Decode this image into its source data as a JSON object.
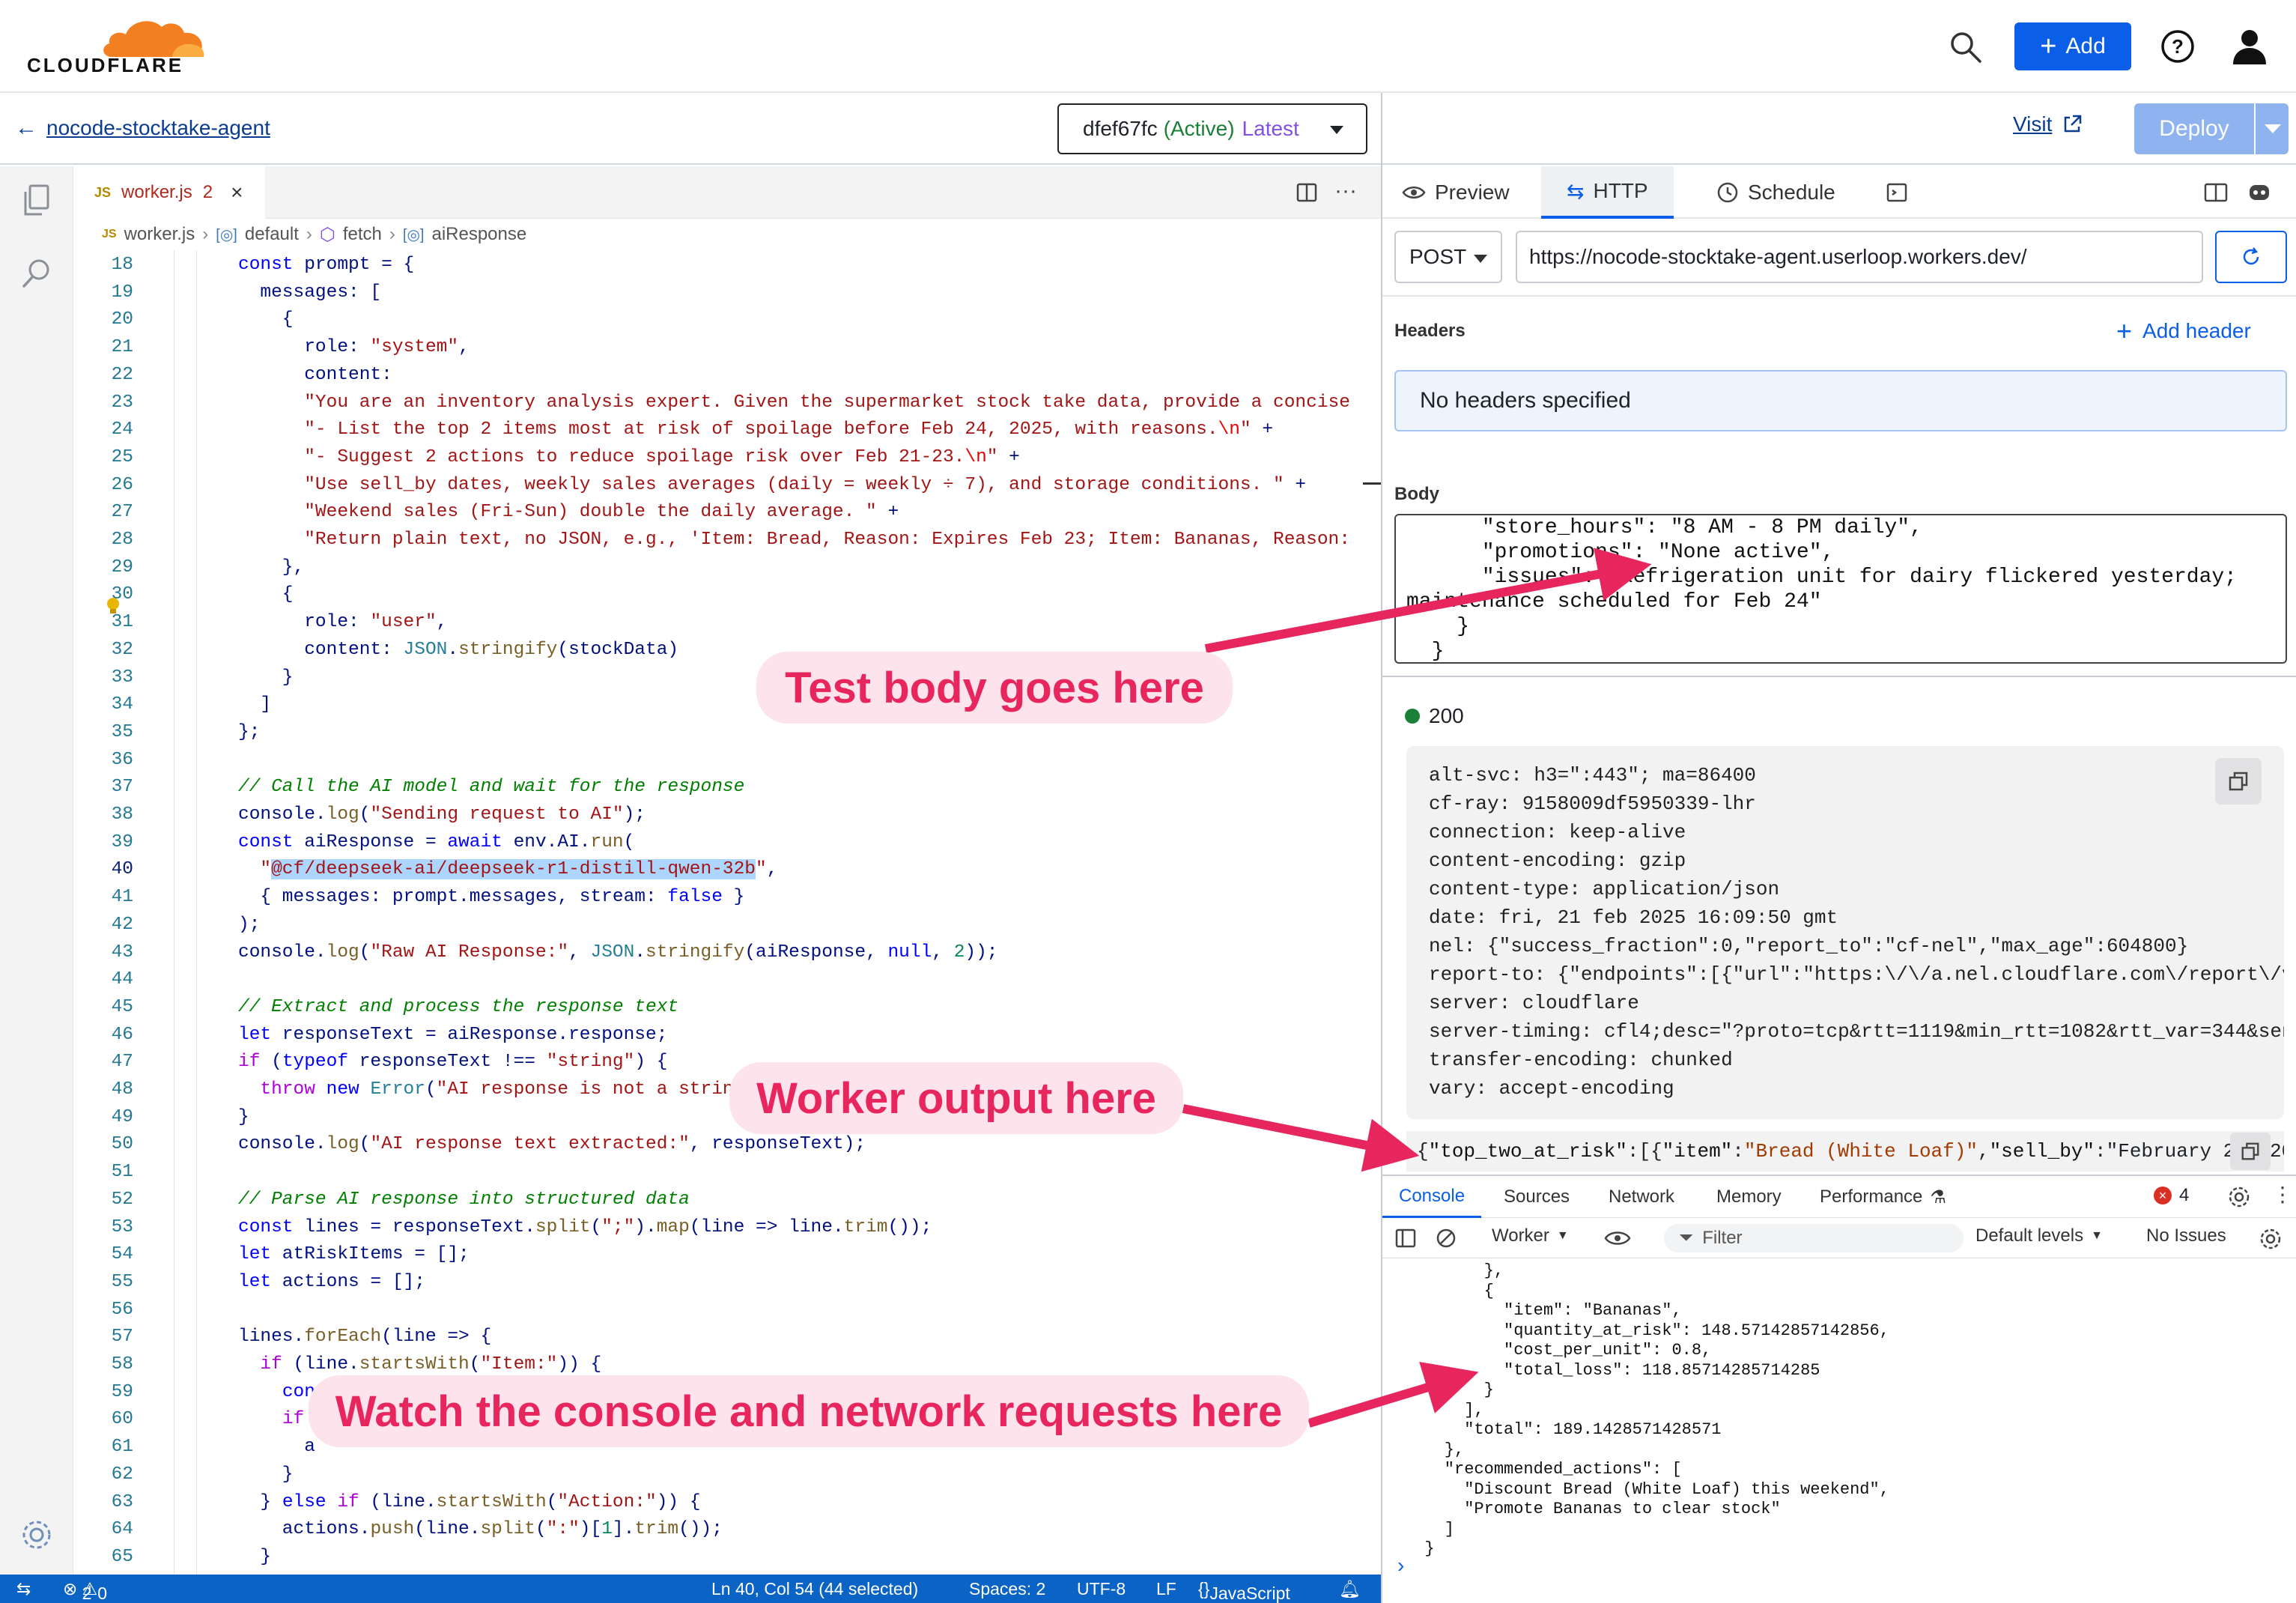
{
  "brand": {
    "name": "CLOUDFLARE",
    "accent": "#f38020"
  },
  "topbar": {
    "add_label": "Add"
  },
  "subbar": {
    "back_label": "nocode-stocktake-agent",
    "version_id": "dfef67fc",
    "version_status": "(Active)",
    "version_tag": "Latest",
    "visit_label": "Visit",
    "deploy_label": "Deploy"
  },
  "editor": {
    "tab_lang": "JS",
    "tab_name": "worker.js",
    "tab_problems": "2",
    "breadcrumb": [
      "worker.js",
      "default",
      "fetch",
      "aiResponse"
    ],
    "lines": [
      {
        "n": "18",
        "t": "const prompt = {"
      },
      {
        "n": "19",
        "t": "  messages: ["
      },
      {
        "n": "20",
        "t": "    {"
      },
      {
        "n": "21",
        "t": "      role: \"system\","
      },
      {
        "n": "22",
        "t": "      content:"
      },
      {
        "n": "23",
        "t": "      \"You are an inventory analysis expert. Given the supermarket stock take data, provide a concise"
      },
      {
        "n": "24",
        "t": "      \"- List the top 2 items most at risk of spoilage before Feb 24, 2025, with reasons.\\n\" +"
      },
      {
        "n": "25",
        "t": "      \"- Suggest 2 actions to reduce spoilage risk over Feb 21-23.\\n\" +"
      },
      {
        "n": "26",
        "t": "      \"Use sell_by dates, weekly sales averages (daily = weekly ÷ 7), and storage conditions. \" +"
      },
      {
        "n": "27",
        "t": "      \"Weekend sales (Fri-Sun) double the daily average. \" +"
      },
      {
        "n": "28",
        "t": "      \"Return plain text, no JSON, e.g., 'Item: Bread, Reason: Expires Feb 23; Item: Bananas, Reason:"
      },
      {
        "n": "29",
        "t": "    },"
      },
      {
        "n": "30",
        "t": "    {"
      },
      {
        "n": "31",
        "t": "      role: \"user\","
      },
      {
        "n": "32",
        "t": "      content: JSON.stringify(stockData)"
      },
      {
        "n": "33",
        "t": "    }"
      },
      {
        "n": "34",
        "t": "  ]"
      },
      {
        "n": "35",
        "t": "};"
      },
      {
        "n": "36",
        "t": ""
      },
      {
        "n": "37",
        "t": "// Call the AI model and wait for the response"
      },
      {
        "n": "38",
        "t": "console.log(\"Sending request to AI\");"
      },
      {
        "n": "39",
        "t": "const aiResponse = await env.AI.run("
      },
      {
        "n": "40",
        "t": "  \"@cf/deepseek-ai/deepseek-r1-distill-qwen-32b\","
      },
      {
        "n": "41",
        "t": "  { messages: prompt.messages, stream: false }"
      },
      {
        "n": "42",
        "t": ");"
      },
      {
        "n": "43",
        "t": "console.log(\"Raw AI Response:\", JSON.stringify(aiResponse, null, 2));"
      },
      {
        "n": "44",
        "t": ""
      },
      {
        "n": "45",
        "t": "// Extract and process the response text"
      },
      {
        "n": "46",
        "t": "let responseText = aiResponse.response;"
      },
      {
        "n": "47",
        "t": "if (typeof responseText !== \"string\") {"
      },
      {
        "n": "48",
        "t": "  throw new Error(\"AI response is not a string\");"
      },
      {
        "n": "49",
        "t": "}"
      },
      {
        "n": "50",
        "t": "console.log(\"AI response text extracted:\", responseText);"
      },
      {
        "n": "51",
        "t": ""
      },
      {
        "n": "52",
        "t": "// Parse AI response into structured data"
      },
      {
        "n": "53",
        "t": "const lines = responseText.split(\";\").map(line => line.trim());"
      },
      {
        "n": "54",
        "t": "let atRiskItems = [];"
      },
      {
        "n": "55",
        "t": "let actions = [];"
      },
      {
        "n": "56",
        "t": ""
      },
      {
        "n": "57",
        "t": "lines.forEach(line => {"
      },
      {
        "n": "58",
        "t": "  if (line.startsWith(\"Item:\")) {"
      },
      {
        "n": "59",
        "t": "    const parts = line.split(\", \").map(part => part.split(\":\")[1]?.trim());"
      },
      {
        "n": "60",
        "t": "    if"
      },
      {
        "n": "61",
        "t": "      a"
      },
      {
        "n": "62",
        "t": "    }"
      },
      {
        "n": "63",
        "t": "  } else if (line.startsWith(\"Action:\")) {"
      },
      {
        "n": "64",
        "t": "    actions.push(line.split(\":\")[1].trim());"
      },
      {
        "n": "65",
        "t": "  }"
      },
      {
        "n": "66",
        "t": "});"
      }
    ]
  },
  "statusbar": {
    "errors": "2",
    "warnings": "0",
    "position": "Ln 40, Col 54 (44 selected)",
    "spaces": "Spaces: 2",
    "encoding": "UTF-8",
    "eol": "LF",
    "language": "JavaScript"
  },
  "right": {
    "tabs": [
      "Preview",
      "HTTP",
      "Schedule"
    ],
    "method": "POST",
    "url": "https://nocode-stocktake-agent.userloop.workers.dev/",
    "headers_label": "Headers",
    "add_header_label": "Add header",
    "no_headers": "No headers specified",
    "body_label": "Body",
    "body_text": "      \"store_hours\": \"8 AM - 8 PM daily\",\n      \"promotions\": \"None active\",\n      \"issues\": \"Refrigeration unit for dairy flickered yesterday;\nmaintenance scheduled for Feb 24\"\n    }\n  }",
    "status_code": "200",
    "response_headers": [
      "alt-svc: h3=\":443\"; ma=86400",
      "cf-ray: 9158009df5950339-lhr",
      "connection: keep-alive",
      "content-encoding: gzip",
      "content-type: application/json",
      "date: fri, 21 feb 2025 16:09:50 gmt",
      "nel: {\"success_fraction\":0,\"report_to\":\"cf-nel\",\"max_age\":604800}",
      "report-to: {\"endpoints\":[{\"url\":\"https:\\/\\/a.nel.cloudflare.com\\/report\\/v4",
      "server: cloudflare",
      "server-timing: cfl4;desc=\"?proto=tcp&rtt=1119&min_rtt=1082&rtt_var=344&sent",
      "transfer-encoding: chunked",
      "vary: accept-encoding"
    ],
    "response_body": "{\"top_two_at_risk\":[{\"item\":\"Bread (White Loaf)\",\"sell_by\":\"February 23, 20"
  },
  "devtools": {
    "tabs": [
      "Console",
      "Sources",
      "Network",
      "Memory",
      "Performance"
    ],
    "issue_count": "4",
    "context": "Worker",
    "filter_placeholder": "Filter",
    "levels": "Default levels",
    "issues_label": "No Issues",
    "console_text": "        },\n        {\n          \"item\": \"Bananas\",\n          \"quantity_at_risk\": 148.57142857142856,\n          \"cost_per_unit\": 0.8,\n          \"total_loss\": 118.85714285714285\n        }\n      ],\n      \"total\": 189.1428571428571\n    },\n    \"recommended_actions\": [\n      \"Discount Bread (White Loaf) this weekend\",\n      \"Promote Bananas to clear stock\"\n    ]\n  }",
    "prompt": "›"
  },
  "annotations": {
    "test_body": "Test body goes here",
    "worker_output": "Worker output here",
    "console_network": "Watch the console and network requests here",
    "color": "#e8265e"
  }
}
